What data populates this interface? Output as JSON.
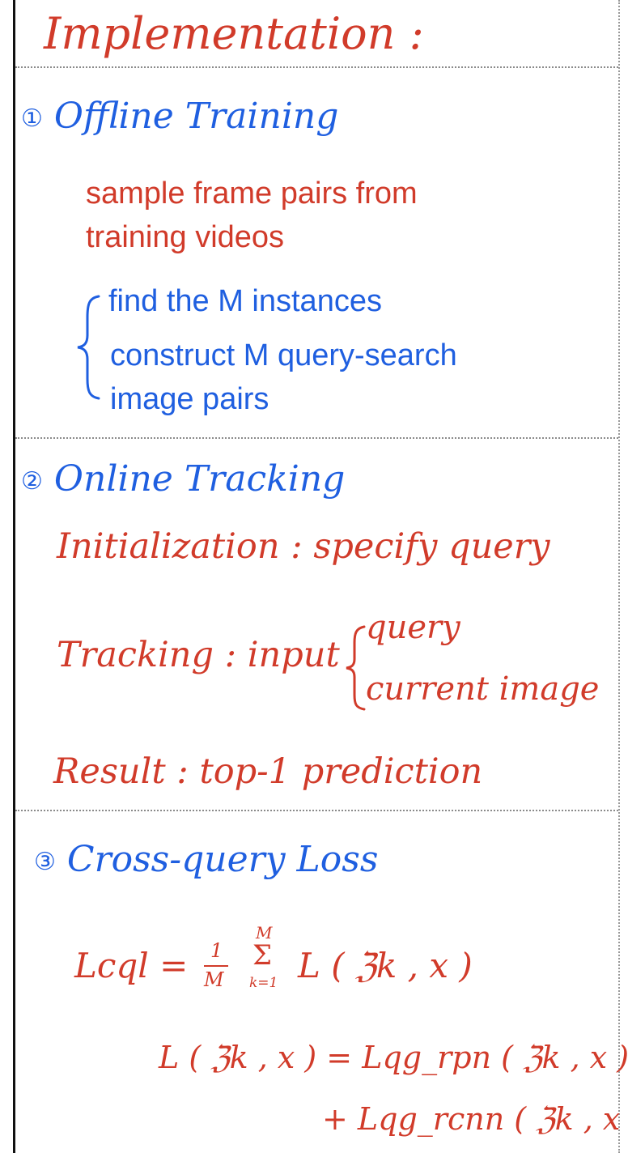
{
  "title": "Implementation :",
  "offline": {
    "heading_num": "①",
    "heading": "Offline Training",
    "line1": "sample frame pairs from",
    "line2": "training videos",
    "step1": "find the M instances",
    "step2a": "construct M query-search",
    "step2b": "image pairs"
  },
  "online": {
    "heading_num": "②",
    "heading": "Online Tracking",
    "init": "Initialization : specify query",
    "tracking": "Tracking : input",
    "input_a": "query",
    "input_b": "current image",
    "result": "Result : top-1 prediction"
  },
  "loss": {
    "heading_num": "③",
    "heading": "Cross-query Loss",
    "eq1_lhs": "Lcql =",
    "frac_num": "1",
    "frac_den": "M",
    "sum_top": "M",
    "sum_symbol": "Σ",
    "sum_bottom": "k=1",
    "eq1_rhs": "L ( ℨk , x )",
    "eq2": "L ( ℨk , x ) = Lqg_rpn ( ℨk , x )",
    "eq3": "+ Lqg_rcnn ( ℨk , x )"
  },
  "colors": {
    "red_ink": "#d13b2a",
    "blue_ink": "#1f5fe0",
    "border": "#111111"
  }
}
